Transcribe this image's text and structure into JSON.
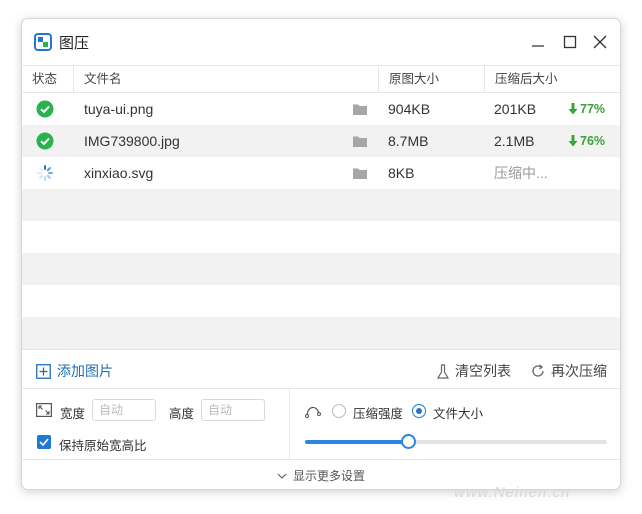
{
  "window": {
    "title": "图压"
  },
  "table": {
    "headers": {
      "status": "状态",
      "name": "文件名",
      "original": "原图大小",
      "compressed": "压缩后大小"
    },
    "rows": [
      {
        "status": "done",
        "name": "tuya-ui.png",
        "original": "904KB",
        "compressed": "201KB",
        "ratio": "77%"
      },
      {
        "status": "done",
        "name": "IMG739800.jpg",
        "original": "8.7MB",
        "compressed": "2.1MB",
        "ratio": "76%"
      },
      {
        "status": "processing",
        "name": "xinxiao.svg",
        "original": "8KB",
        "compressed": "压缩中...",
        "ratio": ""
      }
    ]
  },
  "toolbar": {
    "add_label": "添加图片",
    "clear_label": "清空列表",
    "recompress_label": "再次压缩"
  },
  "settings": {
    "width_label": "宽度",
    "width_placeholder": "自动",
    "height_label": "高度",
    "height_placeholder": "自动",
    "keep_ratio_label": "保持原始宽高比",
    "keep_ratio_checked": true,
    "mode_quality_label": "压缩强度",
    "mode_size_label": "文件大小",
    "selected_mode": "文件大小",
    "slider_value": 0.34
  },
  "footer": {
    "more_settings_label": "显示更多设置"
  },
  "watermark": "www.Neinen.cn",
  "colors": {
    "accent": "#1f78d1",
    "success": "#3aa33a",
    "link": "#1f6fb8"
  }
}
